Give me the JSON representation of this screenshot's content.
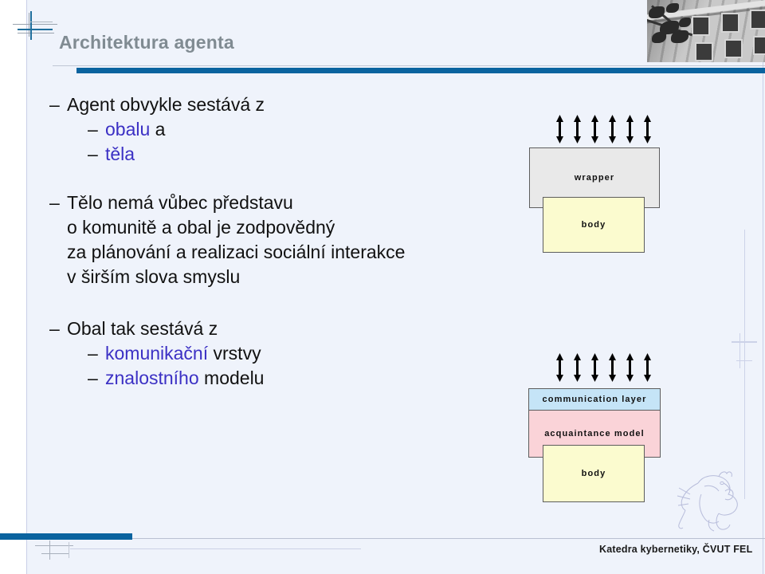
{
  "slide": {
    "title": "Architektura agenta",
    "accent_color": "#3b30c4",
    "bar_color": "#0a639f",
    "title_color": "#808b92",
    "background": "#eff3fb"
  },
  "bullets": [
    {
      "level": 1,
      "dash": "–",
      "text": "Agent obvykle sestává z"
    },
    {
      "level": 2,
      "dash": "–",
      "accent": "obalu",
      "rest": " a"
    },
    {
      "level": 2,
      "dash": "–",
      "accent": "těla",
      "rest": ""
    },
    {
      "level": 1,
      "dash": "–",
      "text": "Tělo nemá vůbec představu"
    },
    {
      "level": 1,
      "dash": "",
      "text": "o komunitě a obal je zodpovědný"
    },
    {
      "level": 1,
      "dash": "",
      "text": "za plánování a realizaci sociální interakce"
    },
    {
      "level": 1,
      "dash": "",
      "text": "v širším slova smyslu"
    },
    {
      "level": 1,
      "dash": "–",
      "text": "Obal tak sestává z"
    },
    {
      "level": 2,
      "dash": "–",
      "accent": "komunikační",
      "rest": " vrstvy"
    },
    {
      "level": 2,
      "dash": "–",
      "accent": "znalostního",
      "rest": " modelu"
    }
  ],
  "text_lines": {
    "l1": "Agent obvykle sestává z",
    "l2_accent": "obalu",
    "l2_rest": " a",
    "l3_accent": "těla",
    "l4": "Tělo nemá vůbec představu",
    "l5": "o komunitě a obal je zodpovědný",
    "l6": "za plánování a realizaci sociální interakce",
    "l7": "v širším slova smyslu",
    "l8": "Obal tak sestává z",
    "l9_accent": "komunikační",
    "l9_rest": " vrstvy",
    "l10_accent": "znalostního",
    "l10_rest": " modelu",
    "dash": "–"
  },
  "diagram_top": {
    "arrow_count": 6,
    "boxes": [
      {
        "label": "wrapper",
        "color": "#e9e9e9"
      },
      {
        "label": "body",
        "color": "#fbfbcf"
      }
    ],
    "wrapper_label": "wrapper",
    "body_label": "body"
  },
  "diagram_bottom": {
    "arrow_count": 6,
    "boxes": [
      {
        "label": "communication layer",
        "color": "#c5e4f7"
      },
      {
        "label": "acquaintance model",
        "color": "#fad3d8"
      },
      {
        "label": "body",
        "color": "#fbfbcf"
      }
    ],
    "comm_label": "communication layer",
    "acq_label": "acquaintance model",
    "body_label": "body"
  },
  "footer": {
    "text": "Katedra kybernetiky, ČVUT FEL"
  }
}
